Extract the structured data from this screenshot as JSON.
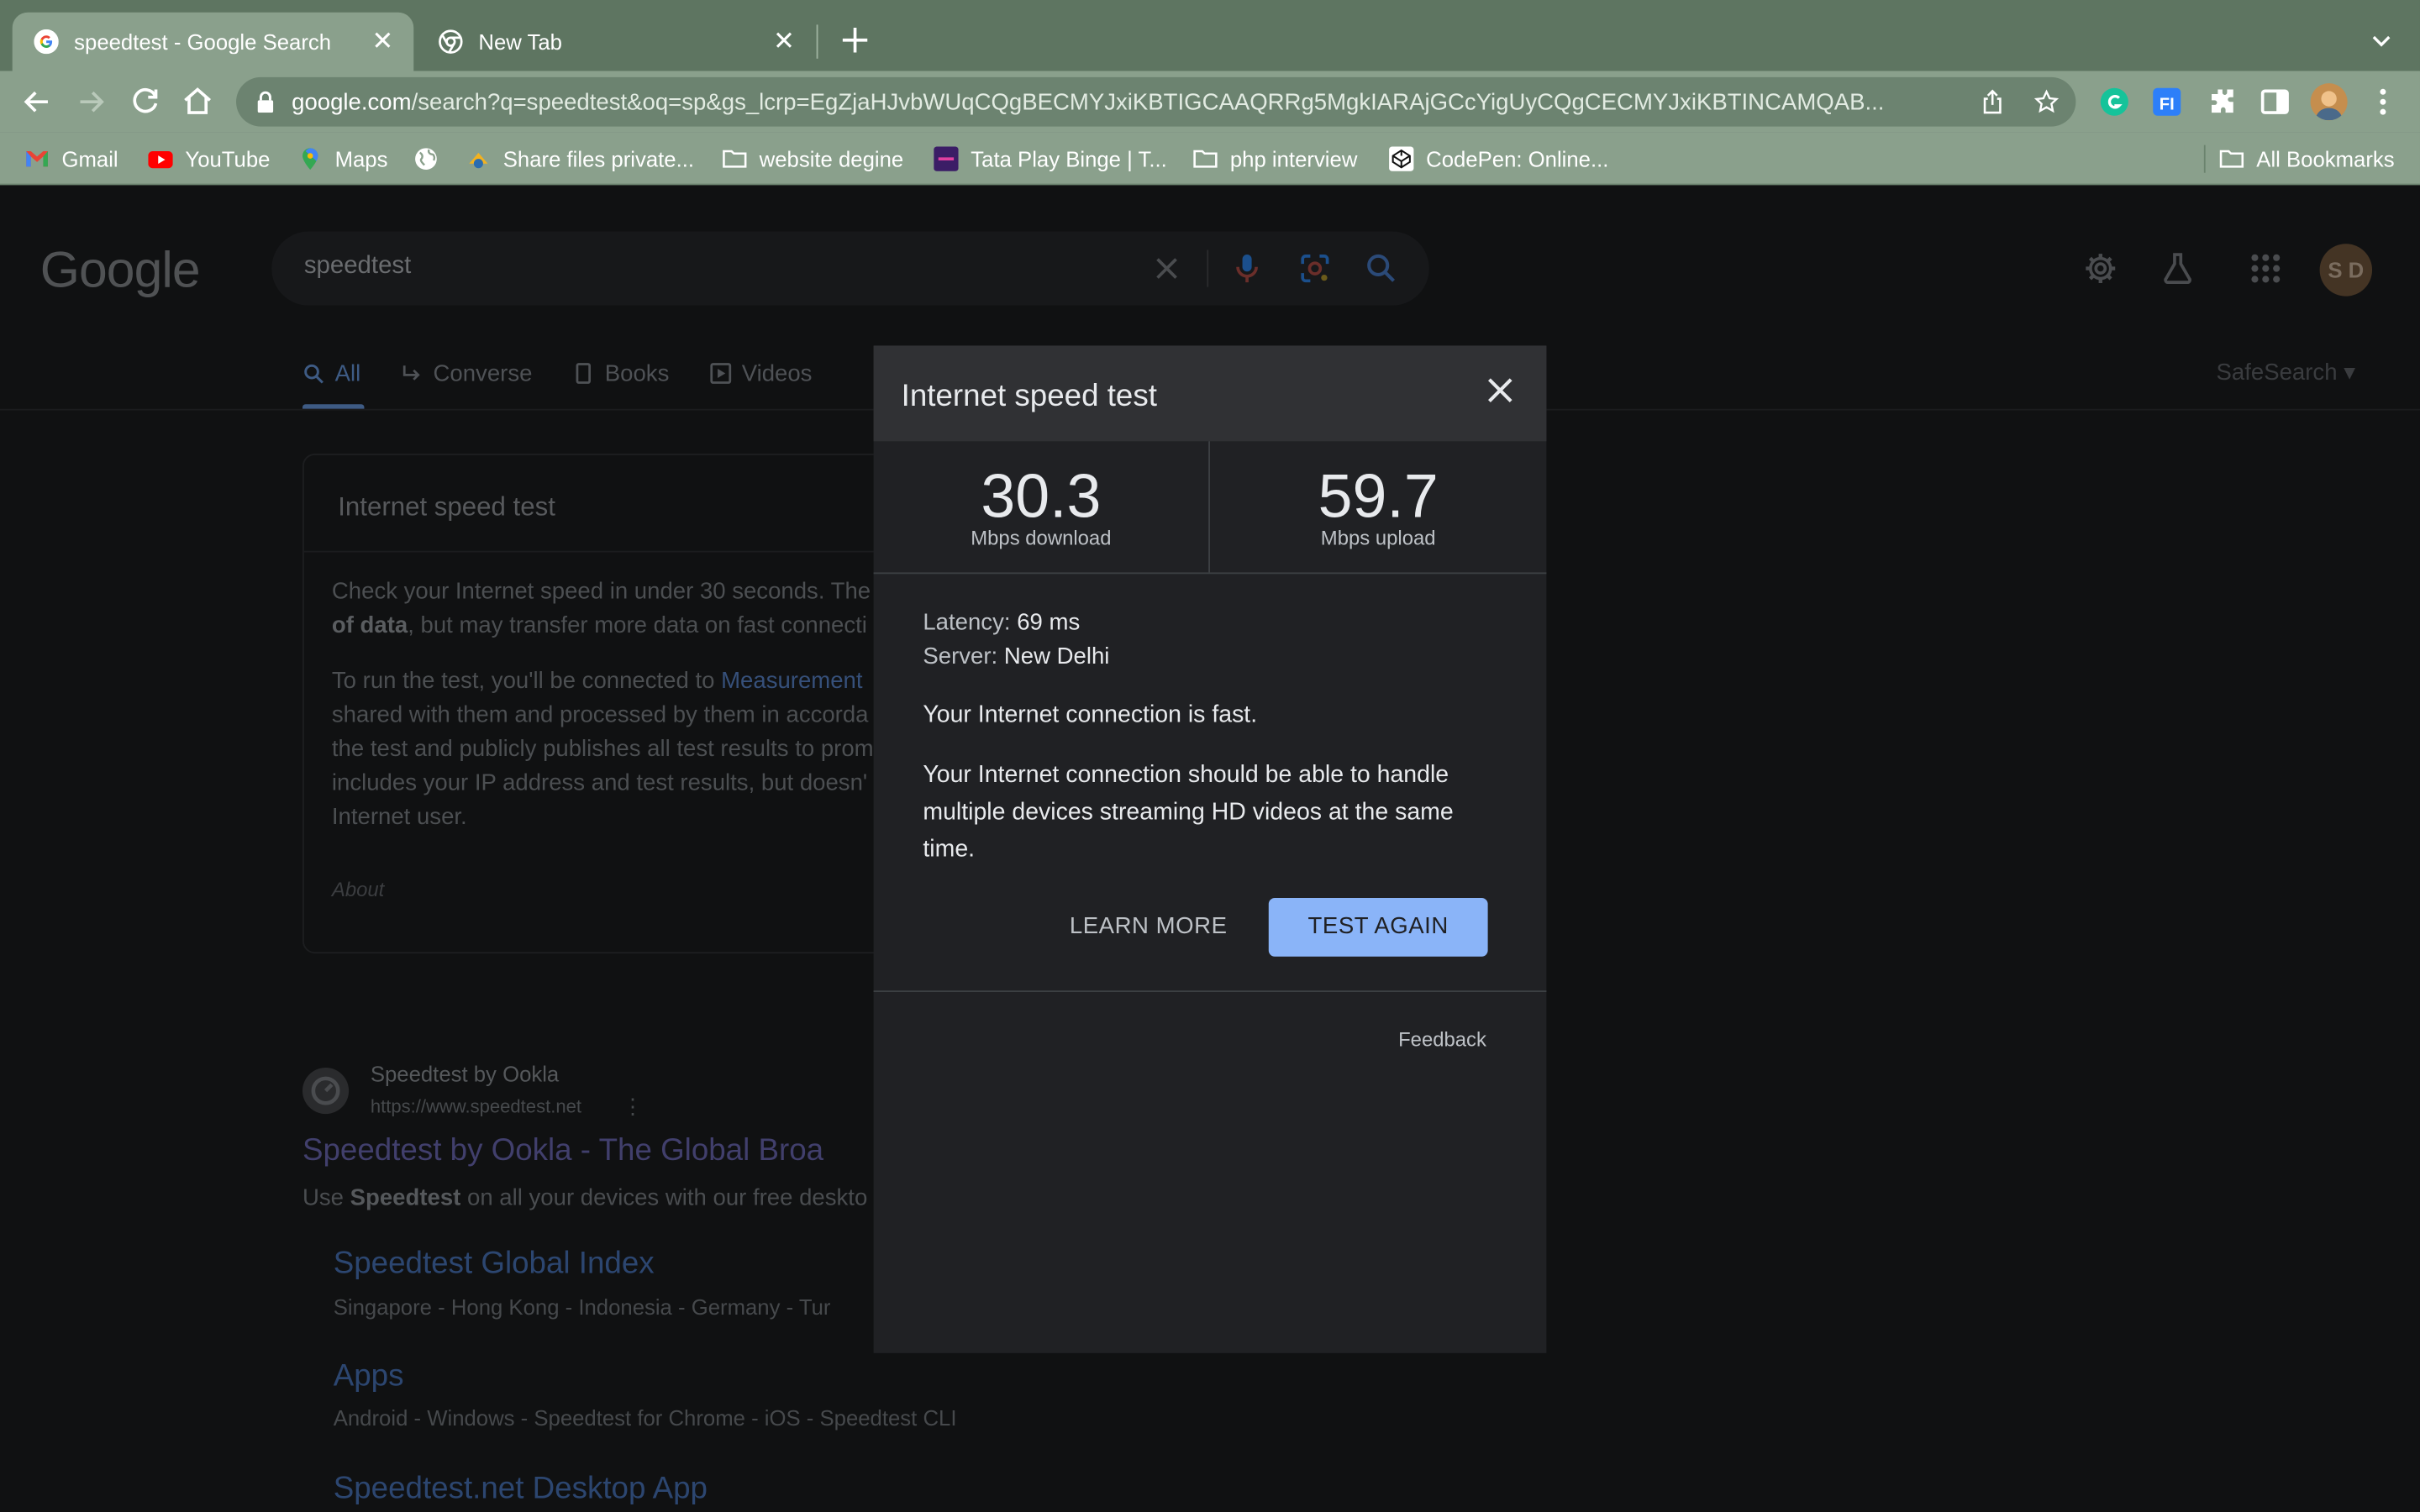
{
  "browser": {
    "tabs": [
      {
        "title": "speedtest - Google Search",
        "active": true,
        "favicon": "google-icon"
      },
      {
        "title": "New Tab",
        "active": false,
        "favicon": "chrome-icon"
      }
    ],
    "url_host": "google.com",
    "url_rest": "/search?q=speedtest&oq=sp&gs_lcrp=EgZjaHJvbWUqCQgBECMYJxiKBTIGCAAQRRg5MgkIARAjGCcYigUyCQgCECMYJxiKBTINCAMQAB...",
    "bookmarks": [
      {
        "label": "Gmail",
        "icon": "gmail-icon"
      },
      {
        "label": "YouTube",
        "icon": "youtube-icon"
      },
      {
        "label": "Maps",
        "icon": "maps-icon"
      },
      {
        "label": "",
        "icon": "globe-icon"
      },
      {
        "label": "Share files private...",
        "icon": "share-icon"
      },
      {
        "label": "website degine",
        "icon": "folder-icon"
      },
      {
        "label": "Tata Play Binge | T...",
        "icon": "tataplay-icon"
      },
      {
        "label": "php interview",
        "icon": "folder-icon"
      },
      {
        "label": "CodePen: Online...",
        "icon": "codepen-icon"
      }
    ],
    "all_bookmarks": "All Bookmarks"
  },
  "google": {
    "logo": "Google",
    "query": "speedtest",
    "avatar_initials": "S D",
    "tabs": [
      "All",
      "Converse",
      "Books",
      "Videos"
    ],
    "safesearch": "SafeSearch",
    "card": {
      "title": "Internet speed test",
      "line1a": "Check your Internet speed in under 30 seconds. The",
      "line2b": "of data",
      "line2c": ", but may transfer more data on fast connecti",
      "line3a": "To run the test, you'll be connected to ",
      "line3link": "Measurement",
      "line4": "shared with them and processed by them in accorda",
      "line5": "the test and publicly publishes all test results to prom",
      "line6": "includes your IP address and test results, but doesn'",
      "line7": "Internet user.",
      "about": "About"
    },
    "result": {
      "site": "Speedtest by Ookla",
      "url": "https://www.speedtest.net",
      "title": "Speedtest by Ookla - The Global Broa",
      "desc_pre": "Use ",
      "desc_bold": "Speedtest",
      "desc_post": " on all your devices with our free deskto",
      "sub": [
        {
          "title": "Speedtest Global Index",
          "desc": "Singapore - Hong Kong - Indonesia - Germany - Tur"
        },
        {
          "title": "Apps",
          "desc": "Android - Windows - Speedtest for Chrome - iOS - Speedtest CLI"
        },
        {
          "title": "Speedtest.net Desktop App",
          "desc": ""
        }
      ]
    }
  },
  "dialog": {
    "title": "Internet speed test",
    "download": {
      "value": "30.3",
      "unit": "Mbps download"
    },
    "upload": {
      "value": "59.7",
      "unit": "Mbps upload"
    },
    "latency_label": "Latency:",
    "latency_value": "69 ms",
    "server_label": "Server:",
    "server_value": "New Delhi",
    "verdict": "Your Internet connection is fast.",
    "detail": "Your Internet connection should be able to handle multiple devices streaming HD videos at the same time.",
    "learn_more": "LEARN MORE",
    "test_again": "TEST AGAIN",
    "feedback": "Feedback"
  },
  "colors": {
    "accent": "#8ab4f8",
    "tabstrip": "#5e7561",
    "toolbar": "#8aa08c",
    "dialog_bg": "#202124"
  }
}
